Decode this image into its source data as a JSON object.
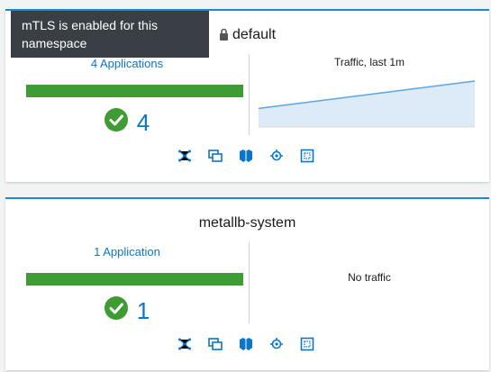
{
  "namespaces": [
    {
      "title": "default",
      "mtls": true,
      "app_count_label": "4 Applications",
      "healthy_count": "4",
      "health_color": "#3f9c35",
      "traffic": {
        "title": "Traffic, last 1m",
        "trend": [
          0.2,
          1.0
        ]
      },
      "icons": [
        "graph-icon",
        "applications-icon",
        "workloads-icon",
        "services-icon",
        "istio-config-icon"
      ]
    },
    {
      "title": "metallb-system",
      "mtls": false,
      "app_count_label": "1 Application",
      "healthy_count": "1",
      "health_color": "#3f9c35",
      "traffic": {
        "empty_label": "No traffic"
      },
      "icons": [
        "graph-icon",
        "applications-icon",
        "workloads-icon",
        "services-icon",
        "istio-config-icon"
      ]
    }
  ],
  "tooltip": {
    "text": "mTLS is enabled for this namespace"
  },
  "colors": {
    "accent": "#0b76c8",
    "border": "#1e88d2",
    "healthy": "#3f9c35",
    "sparkline": "#5aa6e3"
  }
}
